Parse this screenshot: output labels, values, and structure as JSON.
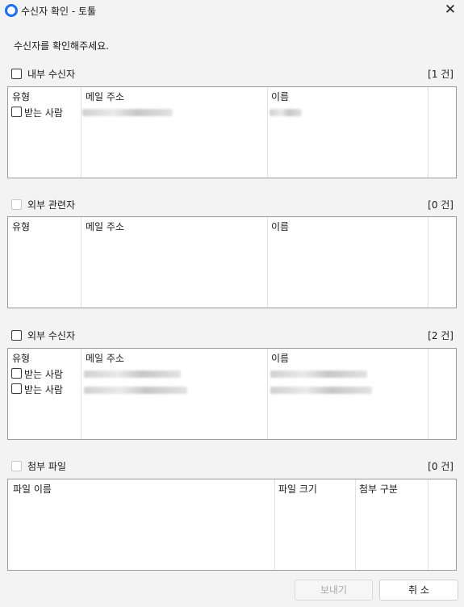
{
  "window": {
    "title": "수신자 확인 - 토툴",
    "close_glyph": "✕"
  },
  "instruction": "수신자를 확인해주세요.",
  "sections": {
    "internal": {
      "title": "내부 수신자",
      "count": "[1 건]",
      "headers": [
        "유형",
        "메일 주소",
        "이름"
      ],
      "rows": [
        {
          "type": "받는 사람"
        }
      ]
    },
    "external_party": {
      "title": "외부 관련자",
      "count": "[0 건]",
      "headers": [
        "유형",
        "메일 주소",
        "이름"
      ]
    },
    "external": {
      "title": "외부 수신자",
      "count": "[2 건]",
      "headers": [
        "유형",
        "메일 주소",
        "이름"
      ],
      "rows": [
        {
          "type": "받는 사람"
        },
        {
          "type": "받는 사람"
        }
      ]
    },
    "attachments": {
      "title": "첨부 파일",
      "count": "[0 건]",
      "headers": [
        "파일 이름",
        "파일 크기",
        "첨부 구분"
      ]
    }
  },
  "buttons": {
    "send": "보내기",
    "cancel": "취 소"
  },
  "colors": {
    "accent": "#1a6ef0"
  }
}
